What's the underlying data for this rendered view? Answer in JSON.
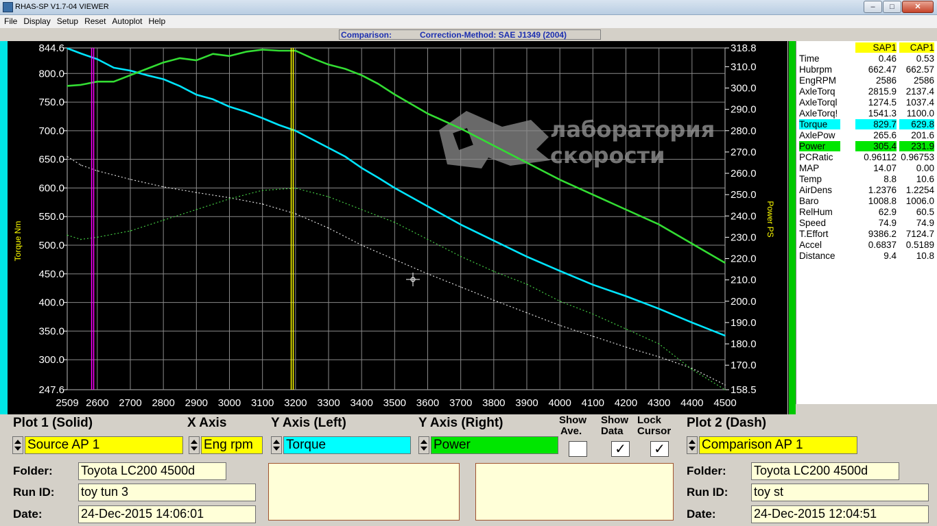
{
  "window": {
    "title": "RHAS-SP V1.7-04  VIEWER",
    "buttons": {
      "minimize": "–",
      "maximize": "□",
      "close": "✕"
    }
  },
  "menu": [
    "File",
    "Display",
    "Setup",
    "Reset",
    "Autoplot",
    "Help"
  ],
  "header": {
    "comparison_label": "Comparison:",
    "correction_method": "Correction-Method: SAE J1349 (2004)"
  },
  "watermark": {
    "line1": "лаборатория",
    "line2": "скорости"
  },
  "chart_data": {
    "type": "line",
    "x_axis": {
      "range": [
        2509,
        4500
      ],
      "tick_labels": [
        "2509",
        "2600",
        "2700",
        "2800",
        "2900",
        "3000",
        "3100",
        "3200",
        "3300",
        "3400",
        "3500",
        "3600",
        "3700",
        "3800",
        "3900",
        "4000",
        "4100",
        "4200",
        "4300",
        "4400",
        "4500"
      ]
    },
    "y_left": {
      "label": "Torque Nm",
      "range": [
        247.6,
        844.6
      ],
      "tick_labels": [
        "844.6",
        "800.0",
        "750.0",
        "700.0",
        "650.0",
        "600.0",
        "550.0",
        "500.0",
        "450.0",
        "400.0",
        "350.0",
        "300.0",
        "247.6"
      ]
    },
    "y_right": {
      "label": "Power PS",
      "range": [
        158.5,
        318.8
      ],
      "tick_labels": [
        "318.8",
        "310.0",
        "300.0",
        "290.0",
        "280.0",
        "270.0",
        "260.0",
        "250.0",
        "240.0",
        "230.0",
        "220.0",
        "210.0",
        "200.0",
        "190.0",
        "180.0",
        "170.0",
        "158.5"
      ]
    },
    "grid": true,
    "cursors": [
      {
        "color": "#ff00ff",
        "x": 2586
      },
      {
        "color": "#ffff00",
        "x": 3190
      }
    ],
    "series": [
      {
        "color": "#00e5ff",
        "style": "solid",
        "axis": "left",
        "x": [
          2509,
          2550,
          2600,
          2650,
          2700,
          2750,
          2800,
          2850,
          2900,
          2950,
          3000,
          3050,
          3100,
          3150,
          3200,
          3250,
          3300,
          3350,
          3400,
          3450,
          3500,
          3600,
          3700,
          3800,
          3900,
          4000,
          4100,
          4200,
          4300,
          4400,
          4500
        ],
        "values": [
          844,
          835,
          825,
          810,
          805,
          797,
          790,
          778,
          763,
          755,
          742,
          733,
          722,
          710,
          700,
          685,
          670,
          655,
          635,
          618,
          600,
          568,
          536,
          508,
          480,
          455,
          431,
          411,
          389,
          365,
          342
        ]
      },
      {
        "color": "#33dd33",
        "style": "solid",
        "axis": "right",
        "x": [
          2509,
          2550,
          2600,
          2650,
          2700,
          2750,
          2800,
          2850,
          2900,
          2950,
          3000,
          3050,
          3100,
          3150,
          3200,
          3250,
          3300,
          3350,
          3400,
          3450,
          3500,
          3600,
          3700,
          3800,
          3900,
          4000,
          4100,
          4200,
          4300,
          4400,
          4500
        ],
        "values": [
          301,
          301.5,
          303,
          303,
          306,
          309,
          312,
          314,
          313,
          316,
          315,
          317,
          318,
          317.5,
          317.5,
          314,
          311,
          309,
          306,
          302,
          297,
          288,
          281,
          273,
          265,
          257,
          250,
          243,
          236,
          227,
          218
        ]
      },
      {
        "color": "#dddddd",
        "style": "dash",
        "axis": "left",
        "x": [
          2509,
          2550,
          2600,
          2700,
          2800,
          2900,
          3000,
          3100,
          3200,
          3300,
          3400,
          3500,
          3600,
          3700,
          3800,
          3900,
          4000,
          4100,
          4200,
          4300,
          4400,
          4500
        ],
        "values": [
          655,
          640,
          630,
          615,
          602,
          592,
          583,
          572,
          555,
          530,
          500,
          475,
          450,
          427,
          404,
          382,
          360,
          341,
          322,
          305,
          285,
          256
        ]
      },
      {
        "color": "#44cc44",
        "style": "dash",
        "axis": "right",
        "x": [
          2509,
          2550,
          2600,
          2700,
          2800,
          2900,
          3000,
          3100,
          3200,
          3300,
          3400,
          3500,
          3600,
          3700,
          3800,
          3900,
          4000,
          4100,
          4200,
          4300,
          4400,
          4500
        ],
        "values": [
          231,
          229,
          230,
          233,
          238,
          243,
          248,
          252,
          253,
          249,
          243,
          237,
          229,
          221,
          214,
          208,
          200,
          194,
          187,
          180,
          168,
          158.5
        ]
      }
    ]
  },
  "readout": {
    "columns": [
      "SAP1",
      "CAP1"
    ],
    "rows": [
      {
        "name": "Time",
        "v1": "0.46",
        "v2": "0.53"
      },
      {
        "name": "Hubrpm",
        "v1": "662.47",
        "v2": "662.57"
      },
      {
        "name": "EngRPM",
        "v1": "2586",
        "v2": "2586"
      },
      {
        "name": "AxleTorq",
        "v1": "2815.9",
        "v2": "2137.4"
      },
      {
        "name": "AxleTorql",
        "v1": "1274.5",
        "v2": "1037.4"
      },
      {
        "name": "AxleTorq!",
        "v1": "1541.3",
        "v2": "1100.0"
      },
      {
        "name": "Torque",
        "v1": "829.7",
        "v2": "629.8",
        "highlight": "#00ffff"
      },
      {
        "name": "AxlePow",
        "v1": "265.6",
        "v2": "201.6"
      },
      {
        "name": "Power",
        "v1": "305.4",
        "v2": "231.9",
        "highlight": "#00e600"
      },
      {
        "name": "PCRatic",
        "v1": "0.96112",
        "v2": "0.96753"
      },
      {
        "name": "MAP",
        "v1": "14.07",
        "v2": "0.00"
      },
      {
        "name": "Temp",
        "v1": "8.8",
        "v2": "10.6"
      },
      {
        "name": "AirDens",
        "v1": "1.2376",
        "v2": "1.2254"
      },
      {
        "name": "Baro",
        "v1": "1008.8",
        "v2": "1006.0"
      },
      {
        "name": "RelHum",
        "v1": "62.9",
        "v2": "60.5"
      },
      {
        "name": "Speed",
        "v1": "74.9",
        "v2": "74.9"
      },
      {
        "name": "T.Effort",
        "v1": "9386.2",
        "v2": "7124.7"
      },
      {
        "name": "Accel",
        "v1": "0.6837",
        "v2": "0.5189"
      },
      {
        "name": "Distance",
        "v1": "9.4",
        "v2": "10.8"
      }
    ]
  },
  "controls": {
    "plot1_label": "Plot 1 (Solid)",
    "plot1_value": "Source AP 1",
    "xaxis_label": "X Axis",
    "xaxis_value": "Eng rpm",
    "yleft_label": "Y Axis (Left)",
    "yleft_value": "Torque",
    "yright_label": "Y Axis (Right)",
    "yright_value": "Power",
    "show_ave_label1": "Show",
    "show_ave_label2": "Ave.",
    "show_data_label1": "Show",
    "show_data_label2": "Data",
    "lock_cursor_label1": "Lock",
    "lock_cursor_label2": "Cursor",
    "check_mark": "✓",
    "plot2_label": "Plot 2 (Dash)",
    "plot2_value": "Comparison AP 1"
  },
  "run1": {
    "folder_label": "Folder:",
    "folder": "Toyota LC200 4500d",
    "runid_label": "Run ID:",
    "runid": "toy tun 3",
    "date_label": "Date:",
    "date": "24-Dec-2015  14:06:01"
  },
  "run2": {
    "folder_label": "Folder:",
    "folder": "Toyota LC200 4500d",
    "runid_label": "Run ID:",
    "runid": "toy st",
    "date_label": "Date:",
    "date": "24-Dec-2015  12:04:51"
  }
}
